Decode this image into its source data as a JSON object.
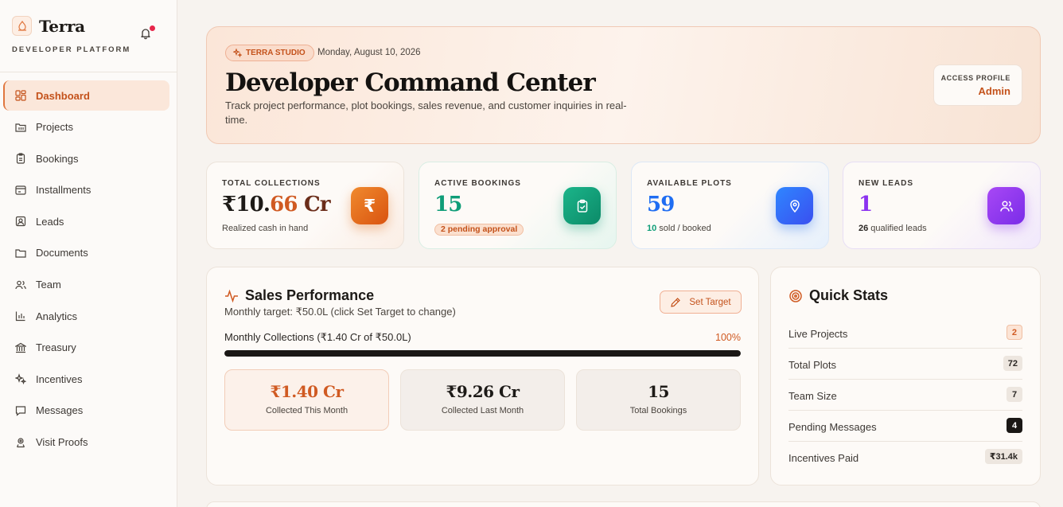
{
  "brand": {
    "name": "Terra",
    "subtitle": "DEVELOPER PLATFORM"
  },
  "nav": [
    {
      "label": "Dashboard",
      "icon": "dashboard-icon",
      "active": true
    },
    {
      "label": "Projects",
      "icon": "projects-icon"
    },
    {
      "label": "Bookings",
      "icon": "bookings-icon"
    },
    {
      "label": "Installments",
      "icon": "installments-icon"
    },
    {
      "label": "Leads",
      "icon": "leads-icon"
    },
    {
      "label": "Documents",
      "icon": "documents-icon"
    },
    {
      "label": "Team",
      "icon": "team-icon"
    },
    {
      "label": "Analytics",
      "icon": "analytics-icon"
    },
    {
      "label": "Treasury",
      "icon": "treasury-icon"
    },
    {
      "label": "Incentives",
      "icon": "incentives-icon"
    },
    {
      "label": "Messages",
      "icon": "messages-icon"
    },
    {
      "label": "Visit Proofs",
      "icon": "visit-proofs-icon"
    }
  ],
  "hero": {
    "chip": "TERRA STUDIO",
    "date": "Monday, August 10, 2026",
    "title": "Developer Command Center",
    "description": "Track project performance, plot bookings, sales revenue, and customer inquiries in real-time.",
    "access_label": "ACCESS PROFILE",
    "access_value": "Admin"
  },
  "stats": {
    "collections": {
      "label": "TOTAL COLLECTIONS",
      "value_prefix": "₹10.",
      "value_accent": "66",
      "value_suffix": " Cr",
      "sub": "Realized cash in hand"
    },
    "bookings": {
      "label": "ACTIVE BOOKINGS",
      "value": "15",
      "badge": "2 pending approval"
    },
    "plots": {
      "label": "AVAILABLE PLOTS",
      "value": "59",
      "sub_count": "10",
      "sub_text": " sold / booked"
    },
    "leads": {
      "label": "NEW LEADS",
      "value": "1",
      "sub_count": "26",
      "sub_text": " qualified leads"
    }
  },
  "sales": {
    "title": "Sales Performance",
    "subtitle": "Monthly target: ₹50.0L (click Set Target to change)",
    "set_target": "Set Target",
    "progress_label": "Monthly Collections (₹1.40 Cr of ₹50.0L)",
    "progress_pct_text": "100%",
    "progress_fraction": 1.0,
    "mini": [
      {
        "value": "₹1.40 Cr",
        "label": "Collected This Month"
      },
      {
        "value": "₹9.26 Cr",
        "label": "Collected Last Month"
      },
      {
        "value": "15",
        "label": "Total Bookings"
      }
    ]
  },
  "quick_stats": {
    "title": "Quick Stats",
    "rows": [
      {
        "label": "Live Projects",
        "value": "2"
      },
      {
        "label": "Total Plots",
        "value": "72"
      },
      {
        "label": "Team Size",
        "value": "7"
      },
      {
        "label": "Pending Messages",
        "value": "4"
      },
      {
        "label": "Incentives Paid",
        "value": "₹31.4k"
      }
    ]
  },
  "colors": {
    "accent": "#c4521b",
    "collections_icon": "#e06612",
    "bookings_icon": "#0f9d78",
    "plots_icon": "#1f6df2",
    "leads_icon": "#8b32f0"
  }
}
